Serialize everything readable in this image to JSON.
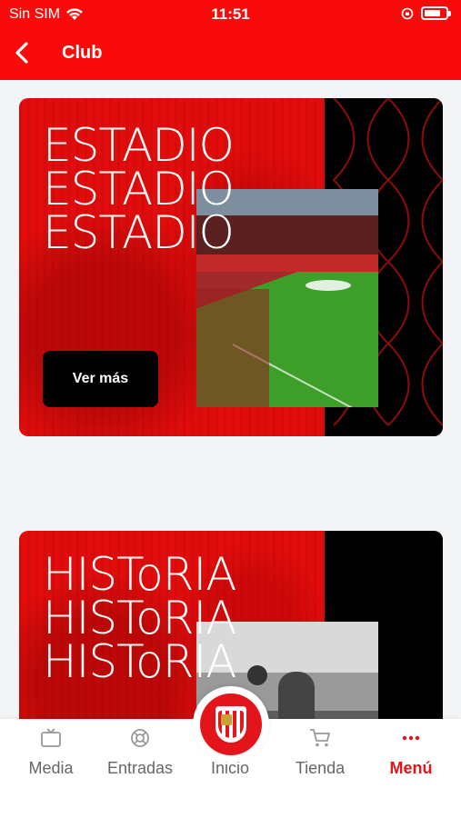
{
  "status_bar": {
    "carrier": "Sin SIM",
    "time": "11:51"
  },
  "header": {
    "title": "Club"
  },
  "cards": [
    {
      "title_lines": [
        "ESTADIO",
        "ESTADIO",
        "ESTADIO"
      ],
      "button_label": "Ver más"
    },
    {
      "title_lines": [
        "HISToRIA",
        "HISToRIA",
        "HISToRIA"
      ]
    }
  ],
  "bottom_nav": {
    "items": [
      {
        "label": "Media",
        "icon": "tv-icon"
      },
      {
        "label": "Entradas",
        "icon": "lifebuoy-icon"
      },
      {
        "label": "Inicio",
        "icon": "club-crest-icon"
      },
      {
        "label": "Tienda",
        "icon": "cart-icon"
      },
      {
        "label": "Menú",
        "icon": "more-dots-icon"
      }
    ],
    "active": "Menú"
  },
  "colors": {
    "brand_red": "#fa0b0b",
    "active_red": "#e4141b",
    "inactive_gray": "#666666"
  }
}
